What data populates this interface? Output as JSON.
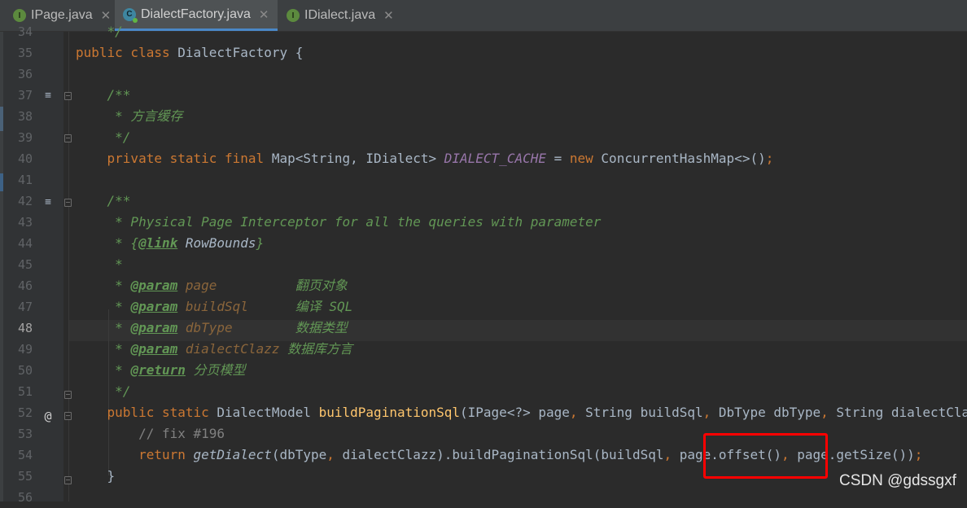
{
  "tabs": [
    {
      "label": "IPage.java",
      "icon": "interface-file-icon",
      "glyph": "I",
      "active": false
    },
    {
      "label": "DialectFactory.java",
      "icon": "class-file-icon",
      "glyph": "C",
      "active": true
    },
    {
      "label": "IDialect.java",
      "icon": "interface-file-icon",
      "glyph": "I",
      "active": false
    }
  ],
  "close_glyph": "✕",
  "editor": {
    "current_line": "48",
    "line_numbers": [
      "34",
      "35",
      "36",
      "37",
      "38",
      "39",
      "40",
      "41",
      "42",
      "43",
      "44",
      "45",
      "46",
      "47",
      "48",
      "49",
      "50",
      "51",
      "52",
      "53",
      "54",
      "55",
      "56"
    ],
    "gutter": {
      "override_marker": "@",
      "doc_glyph": "≡"
    },
    "lines": [
      [
        {
          "t": "    */",
          "c": "cm"
        }
      ],
      [
        {
          "t": "public class ",
          "c": "kw"
        },
        {
          "t": "DialectFactory {",
          "c": ""
        }
      ],
      [],
      [
        {
          "t": "    /**",
          "c": "cm"
        }
      ],
      [
        {
          "t": "     * 方言缓存",
          "c": "cm"
        }
      ],
      [
        {
          "t": "     */",
          "c": "cm"
        }
      ],
      [
        {
          "t": "    private static final ",
          "c": "kw"
        },
        {
          "t": "Map<String, IDialect> ",
          "c": ""
        },
        {
          "t": "DIALECT_CACHE",
          "c": "cst"
        },
        {
          "t": " = ",
          "c": ""
        },
        {
          "t": "new ",
          "c": "kw"
        },
        {
          "t": "ConcurrentHashMap<>()",
          "c": ""
        },
        {
          "t": ";",
          "c": "kw"
        }
      ],
      [],
      [
        {
          "t": "    /**",
          "c": "cm"
        }
      ],
      [
        {
          "t": "     * Physical Page Interceptor for all the queries with parameter",
          "c": "cm"
        }
      ],
      [
        {
          "t": "     * {",
          "c": "cm"
        },
        {
          "t": "@link",
          "c": "tag"
        },
        {
          "t": " RowBounds",
          "c": "it"
        },
        {
          "t": "}",
          "c": "cm"
        }
      ],
      [
        {
          "t": "     *",
          "c": "cm"
        }
      ],
      [
        {
          "t": "     * ",
          "c": "cm"
        },
        {
          "t": "@param",
          "c": "tag"
        },
        {
          "t": " page          ",
          "c": "pr"
        },
        {
          "t": "翻页对象",
          "c": "cm"
        }
      ],
      [
        {
          "t": "     * ",
          "c": "cm"
        },
        {
          "t": "@param",
          "c": "tag"
        },
        {
          "t": " buildSql      ",
          "c": "pr"
        },
        {
          "t": "编译 SQL",
          "c": "cm"
        }
      ],
      [
        {
          "t": "     * ",
          "c": "cm"
        },
        {
          "t": "@param",
          "c": "tag"
        },
        {
          "t": " dbType        ",
          "c": "pr"
        },
        {
          "t": "数据类型",
          "c": "cm"
        }
      ],
      [
        {
          "t": "     * ",
          "c": "cm"
        },
        {
          "t": "@param",
          "c": "tag"
        },
        {
          "t": " dialectClazz ",
          "c": "pr"
        },
        {
          "t": "数据库方言",
          "c": "cm"
        }
      ],
      [
        {
          "t": "     * ",
          "c": "cm"
        },
        {
          "t": "@return",
          "c": "tag"
        },
        {
          "t": " 分页模型",
          "c": "cm"
        }
      ],
      [
        {
          "t": "     */",
          "c": "cm"
        }
      ],
      [
        {
          "t": "    public static ",
          "c": "kw"
        },
        {
          "t": "DialectModel ",
          "c": ""
        },
        {
          "t": "buildPaginationSql",
          "c": "fn"
        },
        {
          "t": "(IPage<?> page",
          "c": ""
        },
        {
          "t": ", ",
          "c": "kw"
        },
        {
          "t": "String buildSql",
          "c": ""
        },
        {
          "t": ", ",
          "c": "kw"
        },
        {
          "t": "DbType dbType",
          "c": ""
        },
        {
          "t": ", ",
          "c": "kw"
        },
        {
          "t": "String dialectClazz) ",
          "c": ""
        }
      ],
      [
        {
          "t": "        // fix #196",
          "c": "lc"
        }
      ],
      [
        {
          "t": "        return ",
          "c": "kw"
        },
        {
          "t": "getDialect",
          "c": "it"
        },
        {
          "t": "(dbType",
          "c": ""
        },
        {
          "t": ", ",
          "c": "kw"
        },
        {
          "t": "dialectClazz).buildPaginationSql(buildSql",
          "c": ""
        },
        {
          "t": ", ",
          "c": "kw"
        },
        {
          "t": "page.offset()",
          "c": ""
        },
        {
          "t": ", ",
          "c": "kw"
        },
        {
          "t": "page.getSize())",
          "c": ""
        },
        {
          "t": ";",
          "c": "kw"
        }
      ],
      [
        {
          "t": "    }",
          "c": ""
        }
      ],
      []
    ]
  },
  "watermark": "CSDN @gdssgxf",
  "colors": {
    "keyword": "#cc7832",
    "doc_comment": "#629755",
    "constant": "#9876aa",
    "method": "#ffc66d",
    "highlight_box": "#ff0000"
  }
}
